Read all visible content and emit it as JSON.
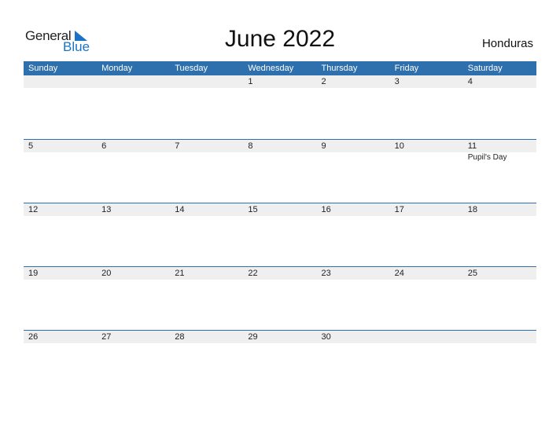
{
  "logo": {
    "general": "General",
    "blue": "Blue"
  },
  "title": "June 2022",
  "country": "Honduras",
  "colors": {
    "accent": "#2e6fad",
    "date_bar": "#efefef",
    "logo_blue": "#1a73c5"
  },
  "weekdays": [
    "Sunday",
    "Monday",
    "Tuesday",
    "Wednesday",
    "Thursday",
    "Friday",
    "Saturday"
  ],
  "weeks": [
    {
      "days": [
        "",
        "",
        "",
        "1",
        "2",
        "3",
        "4"
      ],
      "events": [
        "",
        "",
        "",
        "",
        "",
        "",
        ""
      ]
    },
    {
      "days": [
        "5",
        "6",
        "7",
        "8",
        "9",
        "10",
        "11"
      ],
      "events": [
        "",
        "",
        "",
        "",
        "",
        "",
        "Pupil's Day"
      ]
    },
    {
      "days": [
        "12",
        "13",
        "14",
        "15",
        "16",
        "17",
        "18"
      ],
      "events": [
        "",
        "",
        "",
        "",
        "",
        "",
        ""
      ]
    },
    {
      "days": [
        "19",
        "20",
        "21",
        "22",
        "23",
        "24",
        "25"
      ],
      "events": [
        "",
        "",
        "",
        "",
        "",
        "",
        ""
      ]
    },
    {
      "days": [
        "26",
        "27",
        "28",
        "29",
        "30",
        "",
        ""
      ],
      "events": [
        "",
        "",
        "",
        "",
        "",
        "",
        ""
      ]
    }
  ]
}
